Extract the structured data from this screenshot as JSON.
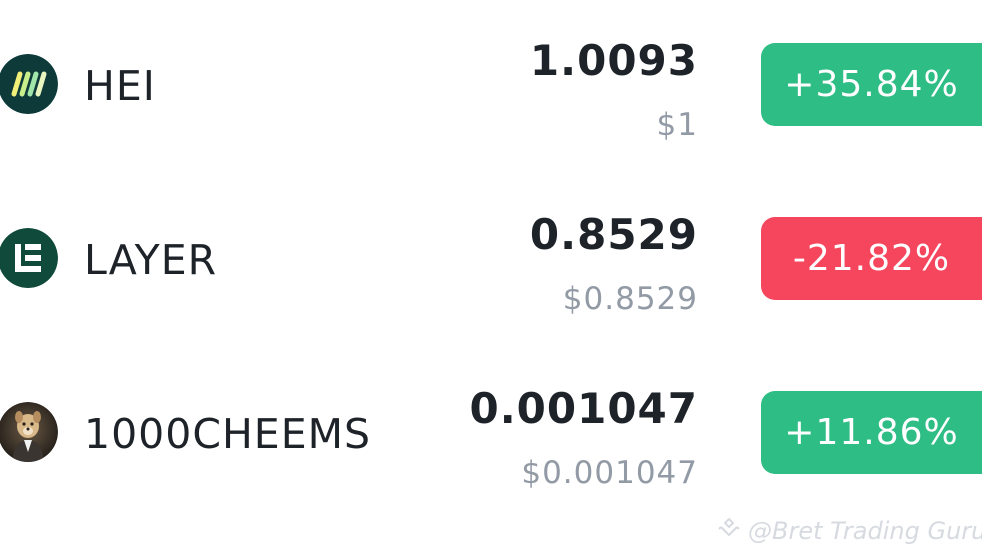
{
  "colors": {
    "positive": "#2ebd85",
    "negative": "#f6465d",
    "primary_text": "#1e2329",
    "secondary_text": "#929aa5"
  },
  "rows": [
    {
      "symbol": "HEI",
      "icon": "hei-token-icon",
      "price": "1.0093",
      "usd_price": "$1",
      "change": "+35.84%",
      "direction": "up"
    },
    {
      "symbol": "LAYER",
      "icon": "layer-token-icon",
      "price": "0.8529",
      "usd_price": "$0.8529",
      "change": "-21.82%",
      "direction": "down"
    },
    {
      "symbol": "1000CHEEMS",
      "icon": "cheems-token-icon",
      "price": "0.001047",
      "usd_price": "$0.001047",
      "change": "+11.86%",
      "direction": "up"
    }
  ],
  "watermark": {
    "icon": "binance-square-logo-icon",
    "text": "@Bret Trading Guru"
  }
}
